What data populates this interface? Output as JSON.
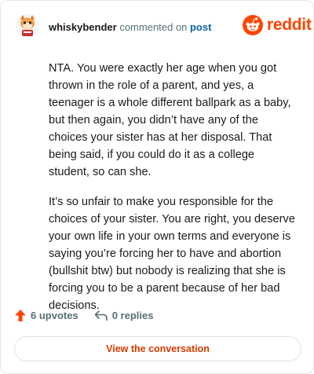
{
  "comment": {
    "author": "whiskybender",
    "action_text": "commented on",
    "post_link": "post",
    "paragraphs": [
      "NTA. You were exactly her age when you got thrown in the role of a parent, and yes, a teenager is a whole different ballpark as a baby, but then again, you didn’t have any of the choices your sister has at her disposal. That being said, if you could do it as a college student, so can she.",
      "It’s so unfair to make you responsible for the choices of your sister. You are right, you deserve your own life in your own terms and everyone is saying you’re forcing her to have and abortion (bullshit btw) but nobody is realizing that she is forcing you to be a parent because of her bad decisions."
    ]
  },
  "brand": {
    "name": "reddit",
    "icon": "reddit-snoo-icon",
    "color": "#ff4500"
  },
  "footer": {
    "upvotes_label": "6 upvotes",
    "replies_label": "0 replies",
    "cta_label": "View the conversation"
  },
  "colors": {
    "accent": "#ff4500",
    "link": "#0b61a4",
    "muted": "#576f76",
    "cta_text": "#d93a00"
  }
}
